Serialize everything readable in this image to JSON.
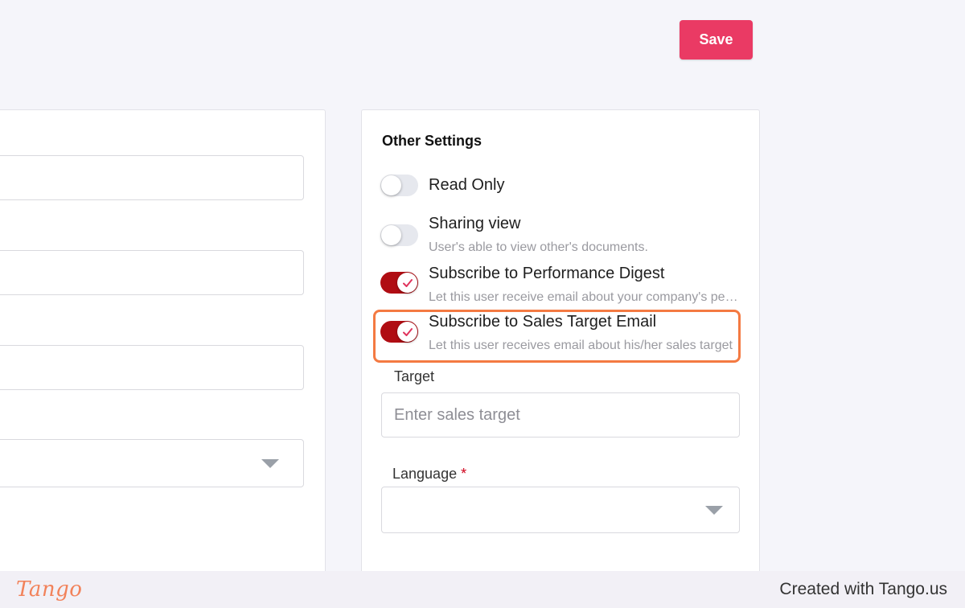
{
  "toolbar": {
    "save_label": "Save"
  },
  "other_settings": {
    "title": "Other Settings",
    "options": [
      {
        "label": "Read Only",
        "description": "",
        "enabled": false
      },
      {
        "label": "Sharing view",
        "description": "User's able to view other's documents.",
        "enabled": false
      },
      {
        "label": "Subscribe to Performance Digest",
        "description": "Let this user receive email about your company's performance digest",
        "enabled": true
      },
      {
        "label": "Subscribe to Sales Target Email",
        "description": "Let this user receives email about his/her sales target",
        "enabled": true
      }
    ],
    "target": {
      "label": "Target",
      "placeholder": "Enter sales target",
      "value": ""
    },
    "language": {
      "label": "Language",
      "required_mark": "*",
      "value": ""
    }
  },
  "footer": {
    "logo_text": "Tango",
    "created_text": "Created with Tango.us"
  },
  "colors": {
    "accent": "#ea3a64",
    "toggle_on": "#b00d13",
    "highlight": "#f47a42"
  }
}
